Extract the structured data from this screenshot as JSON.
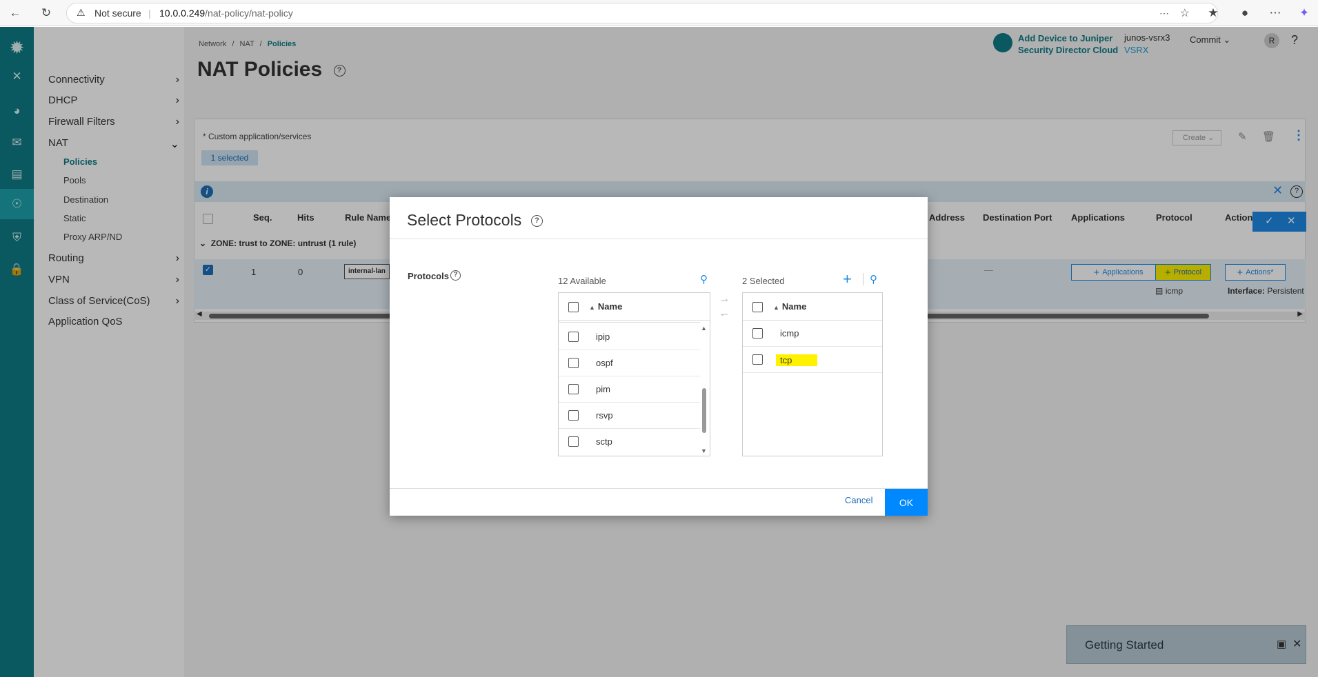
{
  "browser": {
    "security": "Not secure",
    "url_host": "10.0.0.249",
    "url_path": "/nat-policy/nat-policy"
  },
  "sidebar": {
    "items": [
      {
        "label": "Connectivity"
      },
      {
        "label": "DHCP"
      },
      {
        "label": "Firewall Filters"
      },
      {
        "label": "NAT"
      },
      {
        "label": "Routing"
      },
      {
        "label": "VPN"
      },
      {
        "label": "Class of Service(CoS)"
      },
      {
        "label": "Application QoS"
      }
    ],
    "nat_sub": [
      "Policies",
      "Pools",
      "Destination",
      "Static",
      "Proxy ARP/ND"
    ]
  },
  "breadcrumb": {
    "a": "Network",
    "b": "NAT",
    "c": "Policies",
    "sep": "/"
  },
  "page": {
    "title": "NAT Policies"
  },
  "header": {
    "brand_line1": "Add Device to Juniper",
    "brand_line2": "Security Director Cloud",
    "device_name": "junos-vsrx3",
    "device_model": "VSRX",
    "commit": "Commit",
    "avatar": "R",
    "help": "?"
  },
  "panel": {
    "custom_note": "* Custom application/services",
    "selected_badge": "1 selected",
    "create": "Create",
    "columns": {
      "seq": "Seq.",
      "hits": "Hits",
      "rule_name": "Rule Name",
      "address": "Address",
      "dest_port": "Destination Port",
      "applications": "Applications",
      "protocol": "Protocol",
      "actions": "Actions"
    },
    "zone_row": "ZONE: trust to ZONE: untrust (1 rule)",
    "row": {
      "seq": "1",
      "hits": "0",
      "rule_name": "internal-lan",
      "dest_port": "—",
      "applications_btn": "Applications",
      "protocol_btn": "Protocol",
      "actions_btn": "Actions*",
      "protocol_value": "icmp",
      "interface_label": "Interface:",
      "interface_value": "Persistent"
    }
  },
  "dialog": {
    "title": "Select Protocols",
    "protocols_label": "Protocols",
    "available_count": "12 Available",
    "selected_count": "2 Selected",
    "name_header": "Name",
    "available": [
      "ipip",
      "ospf",
      "pim",
      "rsvp",
      "sctp"
    ],
    "selected": [
      "icmp",
      "tcp"
    ],
    "cancel": "Cancel",
    "ok": "OK"
  },
  "getting_started": {
    "title": "Getting Started"
  },
  "colors": {
    "accent": "#0e7c86",
    "blue": "#1e88e5",
    "ok": "#0088ff",
    "highlight": "#fff200"
  }
}
